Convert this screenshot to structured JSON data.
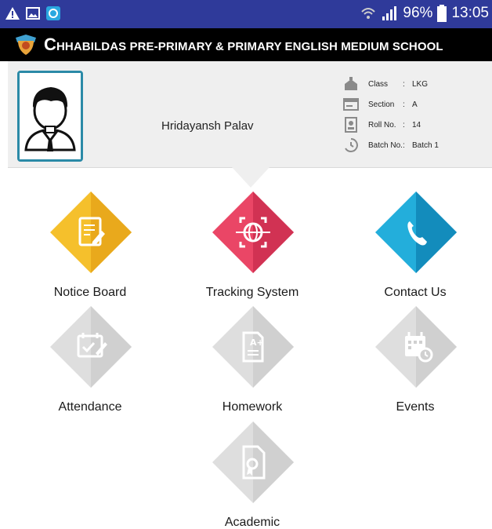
{
  "status_bar": {
    "left_icons": [
      "warning-icon",
      "image-icon",
      "sync-icon"
    ],
    "signal_icons": [
      "wifi-icon",
      "cell-signal-icon"
    ],
    "battery": "96%",
    "time": "13:05"
  },
  "app_bar": {
    "logo_icon": "school-crest-icon",
    "title_first_letter": "C",
    "title_rest": "HHABILDAS PRE-PRIMARY & PRIMARY ENGLISH MEDIUM SCHOOL"
  },
  "profile": {
    "name": "Hridayansh Palav",
    "fields": [
      {
        "icon": "class-building-icon",
        "label": "Class",
        "value": "LKG"
      },
      {
        "icon": "section-board-icon",
        "label": "Section",
        "value": "A"
      },
      {
        "icon": "id-badge-icon",
        "label": "Roll No.",
        "value": "14"
      },
      {
        "icon": "batch-clock-icon",
        "label": "Batch No.",
        "value": "Batch 1"
      }
    ]
  },
  "tiles": [
    {
      "label": "Notice Board",
      "icon": "notice-board-icon",
      "active": true,
      "colors": [
        "#f5c02c",
        "#e7a81b"
      ]
    },
    {
      "label": "Tracking System",
      "icon": "tracking-globe-icon",
      "active": true,
      "colors": [
        "#ea4666",
        "#cf2f52"
      ]
    },
    {
      "label": "Contact Us",
      "icon": "phone-icon",
      "active": true,
      "colors": [
        "#1ea7d6",
        "#118bbb"
      ]
    },
    {
      "label": "Attendance",
      "icon": "attendance-icon",
      "active": false,
      "colors": [
        "#dcdcdc",
        "#cfcfcf"
      ]
    },
    {
      "label": "Homework",
      "icon": "homework-icon",
      "active": false,
      "colors": [
        "#dcdcdc",
        "#cfcfcf"
      ]
    },
    {
      "label": "Events",
      "icon": "events-calendar-icon",
      "active": false,
      "colors": [
        "#dcdcdc",
        "#cfcfcf"
      ]
    },
    {
      "label": "Academic",
      "icon": "academic-certificate-icon",
      "active": false,
      "colors": [
        "#dcdcdc",
        "#cfcfcf"
      ]
    }
  ]
}
